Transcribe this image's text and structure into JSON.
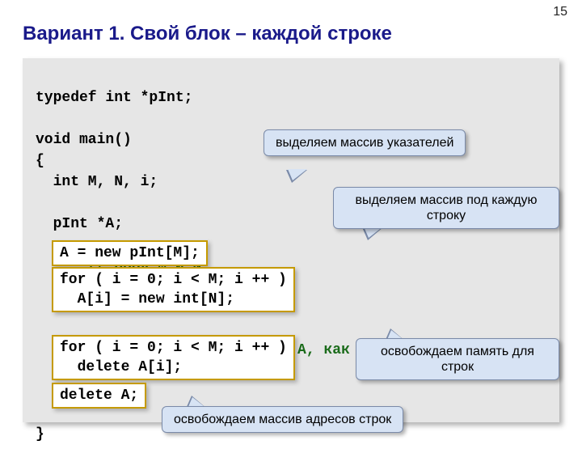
{
  "page_number": "15",
  "title": "Вариант 1. Свой блок – каждой строке",
  "code": {
    "l1": "typedef int *pInt;",
    "l2": "void main()",
    "l3": "{",
    "l4": "  int M, N, i;",
    "l5": "  pInt *A;",
    "l6a": "  ... ",
    "l6b": "// ввод M и N",
    "l7a": "  ...",
    "l7b": "  // работаем с матрицей A, как обычно",
    "l8": "}"
  },
  "boxA": "A = new pInt[M];",
  "boxB": "for ( i = 0; i < M; i ++ )\n  A[i] = new int[N];",
  "boxC": "for ( i = 0; i < M; i ++ )\n  delete A[i];",
  "boxD": "delete A;",
  "callouts": {
    "c1": "выделяем массив\nуказателей",
    "c2": "выделяем массив\nпод каждую строку",
    "c3": "освобождаем память\nдля строк",
    "c4": "освобождаем массив\nадресов строк"
  }
}
